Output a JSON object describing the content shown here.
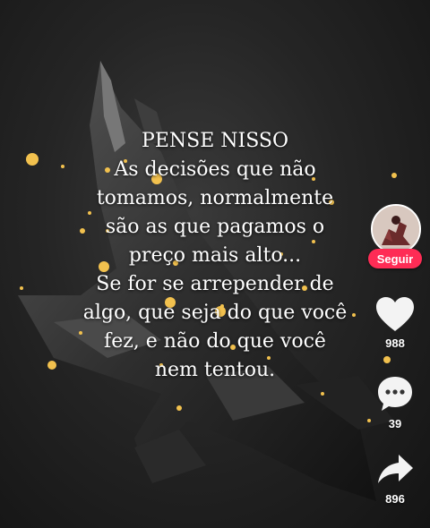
{
  "quote": {
    "title": "PENSE NISSO",
    "lines": [
      "As decisões que não",
      "tomamos, normalmente",
      "são as que pagamos o",
      "preço mais alto...",
      "Se for se arrepender de",
      "algo, que seja do que você",
      "fez, e não do que você",
      "nem tentou."
    ]
  },
  "rail": {
    "follow_label": "Seguir",
    "like_count": "988",
    "comment_count": "39",
    "share_count": "896"
  },
  "icons": {
    "like": "heart-icon",
    "comment": "comment-bubble-icon",
    "share": "share-arrow-icon"
  },
  "colors": {
    "follow_button": "#fe2c55",
    "sparkle": "#f2c14e"
  }
}
